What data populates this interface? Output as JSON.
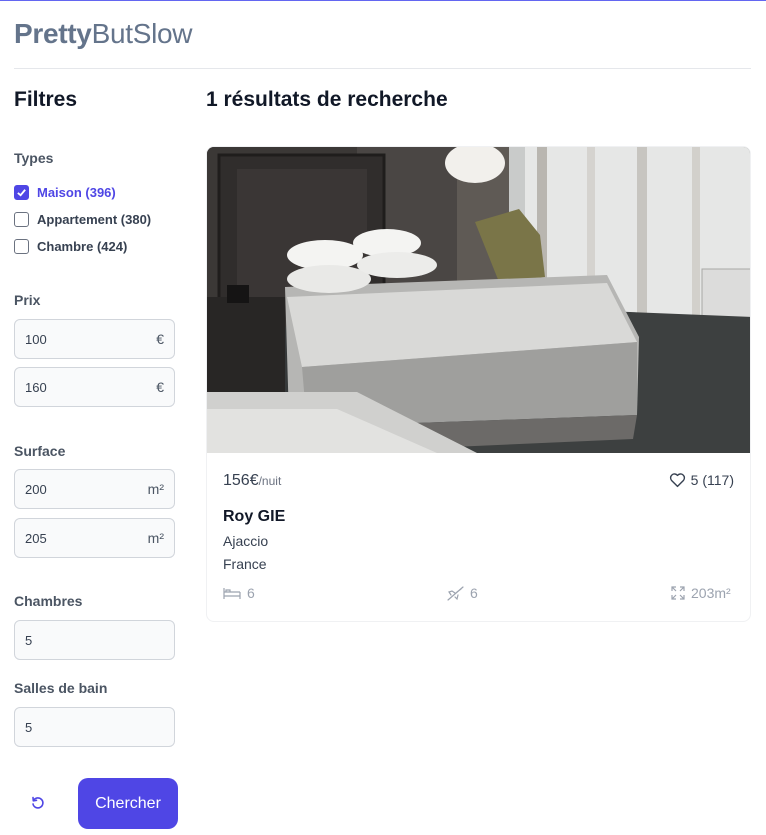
{
  "brand": {
    "bold": "Pretty",
    "light": "ButSlow"
  },
  "filters": {
    "heading": "Filtres",
    "types": {
      "label": "Types",
      "items": [
        {
          "label": "Maison (396)",
          "checked": true
        },
        {
          "label": "Appartement (380)",
          "checked": false
        },
        {
          "label": "Chambre (424)",
          "checked": false
        }
      ]
    },
    "price": {
      "label": "Prix",
      "min": "100",
      "max": "160",
      "unit": "€"
    },
    "surface": {
      "label": "Surface",
      "min": "200",
      "max": "205",
      "unit": "m²"
    },
    "rooms": {
      "label": "Chambres",
      "value": "5"
    },
    "bathrooms": {
      "label": "Salles de bain",
      "value": "5"
    },
    "reset_icon": "reset-icon",
    "search_label": "Chercher"
  },
  "results": {
    "heading": "1 résultats de recherche",
    "items": [
      {
        "price": "156€",
        "per": "/nuit",
        "likes": "5 (117)",
        "name": "Roy GIE",
        "city": "Ajaccio",
        "country": "France",
        "beds": "6",
        "travellers": "6",
        "area": "203m²",
        "icons": [
          "heart-icon",
          "bed-icon",
          "plane-icon",
          "expand-icon"
        ]
      }
    ]
  },
  "colors": {
    "accent": "#4f46e5",
    "muted": "#9ca3af",
    "brand": "#64748b"
  }
}
